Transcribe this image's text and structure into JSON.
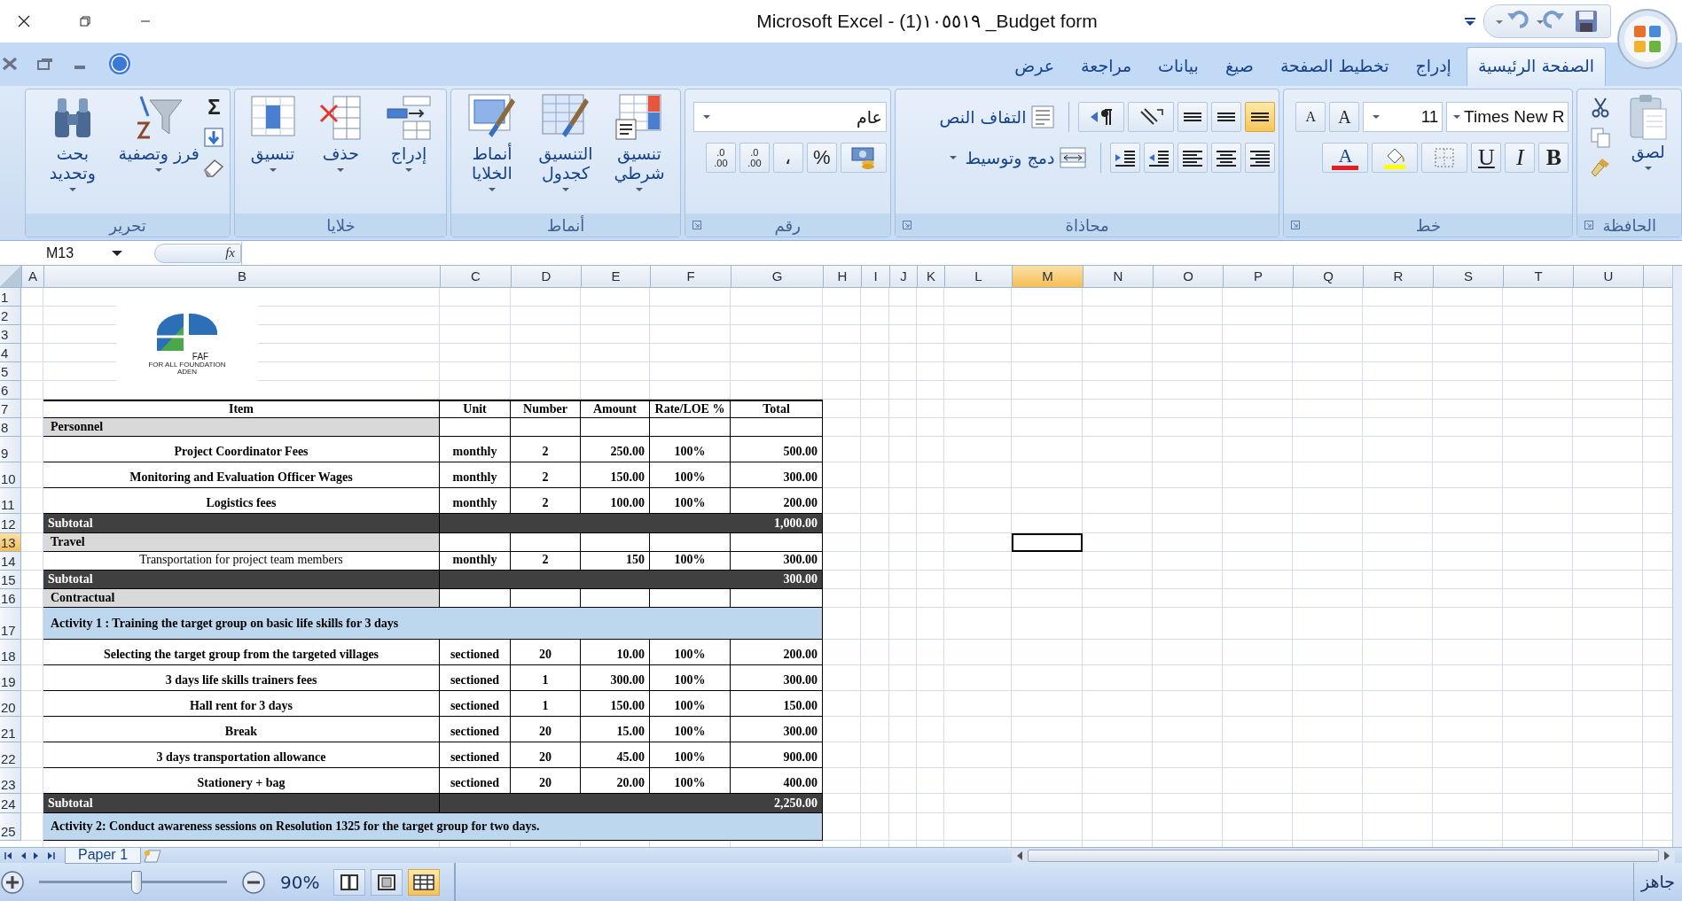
{
  "window": {
    "title": "Microsoft Excel - (1)١٠٥٥١٩ _Budget form"
  },
  "ribbon_tabs": [
    {
      "label": "الصفحة الرئيسية",
      "selected": true
    },
    {
      "label": "إدراج",
      "selected": false
    },
    {
      "label": "تخطيط الصفحة",
      "selected": false
    },
    {
      "label": "صيغ",
      "selected": false
    },
    {
      "label": "بيانات",
      "selected": false
    },
    {
      "label": "مراجعة",
      "selected": false
    },
    {
      "label": "عرض",
      "selected": false
    }
  ],
  "clipboard": {
    "title": "الحافظة",
    "paste": "لصق"
  },
  "font": {
    "title": "خط",
    "name": "Times New R",
    "size": "11",
    "grow": "A",
    "shrink": "A",
    "bold": "B",
    "italic": "I",
    "underline": "U",
    "color_letter": "A"
  },
  "alignment": {
    "title": "محاذاة",
    "wrap_text": "التفاف النص",
    "merge_center": "دمج وتوسيط"
  },
  "number": {
    "title": "رقم",
    "format": "عام",
    "percent": "%",
    "comma": "،",
    "decimals": [
      {
        "top": ".0",
        "bottom": ".00"
      },
      {
        "top": ".0",
        "bottom": ".00"
      }
    ]
  },
  "styles": {
    "title": "أنماط",
    "commands": [
      "تنسيق شرطي",
      "التنسيق كجدول",
      "أنماط الخلايا"
    ]
  },
  "cells": {
    "title": "خلايا",
    "commands": [
      "إدراج",
      "حذف",
      "تنسيق"
    ]
  },
  "editing": {
    "title": "تحرير",
    "sum": "Σ",
    "commands": [
      "فرز وتصفية",
      "بحث وتحديد"
    ]
  },
  "formula_bar": {
    "name_box": "M13",
    "function_label": "fx"
  },
  "logo": {
    "mark": "FAF",
    "line_1": "FOR ALL FOUNDATION",
    "line_2": "ADEN"
  },
  "sheet": {
    "columns": [
      {
        "label": "A",
        "selected": false
      },
      {
        "label": "B",
        "selected": false
      },
      {
        "label": "C",
        "selected": false
      },
      {
        "label": "D",
        "selected": false
      },
      {
        "label": "E",
        "selected": false
      },
      {
        "label": "F",
        "selected": false
      },
      {
        "label": "G",
        "selected": false
      },
      {
        "label": "H",
        "selected": false
      },
      {
        "label": "I",
        "selected": false
      },
      {
        "label": "J",
        "selected": false
      },
      {
        "label": "K",
        "selected": false
      },
      {
        "label": "L",
        "selected": false
      },
      {
        "label": "M",
        "selected": true
      },
      {
        "label": "N",
        "selected": false
      },
      {
        "label": "O",
        "selected": false
      },
      {
        "label": "P",
        "selected": false
      },
      {
        "label": "Q",
        "selected": false
      },
      {
        "label": "R",
        "selected": false
      },
      {
        "label": "S",
        "selected": false
      },
      {
        "label": "T",
        "selected": false
      },
      {
        "label": "U",
        "selected": false
      }
    ],
    "rows": [
      {
        "number": "1",
        "selected": false,
        "kind": "blank"
      },
      {
        "number": "2",
        "selected": false,
        "kind": "blank"
      },
      {
        "number": "3",
        "selected": false,
        "kind": "blank"
      },
      {
        "number": "4",
        "selected": false,
        "kind": "blank"
      },
      {
        "number": "5",
        "selected": false,
        "kind": "blank"
      },
      {
        "number": "6",
        "selected": false,
        "kind": "blank"
      },
      {
        "number": "7",
        "selected": false,
        "kind": "header",
        "cells": [
          "Item",
          "Unit",
          "Number",
          "Amount",
          "Rate/LOE %",
          "Total"
        ]
      },
      {
        "number": "8",
        "selected": false,
        "kind": "section",
        "label": "Personnel"
      },
      {
        "number": "9",
        "selected": false,
        "kind": "item",
        "name": "Project Coordinator Fees",
        "bold": true,
        "unit": "monthly",
        "count": "2",
        "amount": "250.00",
        "rate": "100%",
        "total": "500.00"
      },
      {
        "number": "10",
        "selected": false,
        "kind": "item",
        "name": "Monitoring and Evaluation Officer Wages",
        "bold": true,
        "unit": "monthly",
        "count": "2",
        "amount": "150.00",
        "rate": "100%",
        "total": "300.00"
      },
      {
        "number": "11",
        "selected": false,
        "kind": "item",
        "name": "Logistics fees",
        "bold": true,
        "unit": "monthly",
        "count": "2",
        "amount": "100.00",
        "rate": "100%",
        "total": "200.00"
      },
      {
        "number": "12",
        "selected": false,
        "kind": "subtotal",
        "label": "Subtotal",
        "total": "1,000.00"
      },
      {
        "number": "13",
        "selected": true,
        "kind": "section",
        "label": "Travel"
      },
      {
        "number": "14",
        "selected": false,
        "kind": "item",
        "name": "Transportation for project team members",
        "bold": false,
        "unit": "monthly",
        "count": "2",
        "amount": "150",
        "rate": "100%",
        "total": "300.00"
      },
      {
        "number": "15",
        "selected": false,
        "kind": "subtotal",
        "label": "Subtotal",
        "total": "300.00"
      },
      {
        "number": "16",
        "selected": false,
        "kind": "section",
        "label": "Contractual"
      },
      {
        "number": "17",
        "selected": false,
        "kind": "activity",
        "label": "Activity 1 : Training the target group on basic life skills for 3 days"
      },
      {
        "number": "18",
        "selected": false,
        "kind": "item",
        "name": "Selecting the target group from the targeted villages",
        "bold": true,
        "unit": "sectioned",
        "count": "20",
        "amount": "10.00",
        "rate": "100%",
        "total": "200.00"
      },
      {
        "number": "19",
        "selected": false,
        "kind": "item",
        "name": "3 days life skills trainers fees",
        "bold": true,
        "unit": "sectioned",
        "count": "1",
        "amount": "300.00",
        "rate": "100%",
        "total": "300.00"
      },
      {
        "number": "20",
        "selected": false,
        "kind": "item",
        "name": "Hall rent for 3 days",
        "bold": true,
        "unit": "sectioned",
        "count": "1",
        "amount": "150.00",
        "rate": "100%",
        "total": "150.00"
      },
      {
        "number": "21",
        "selected": false,
        "kind": "item",
        "name": "Break",
        "bold": true,
        "unit": "sectioned",
        "count": "20",
        "amount": "15.00",
        "rate": "100%",
        "total": "300.00"
      },
      {
        "number": "22",
        "selected": false,
        "kind": "item",
        "name": "3 days transportation allowance",
        "bold": true,
        "unit": "sectioned",
        "count": "20",
        "amount": "45.00",
        "rate": "100%",
        "total": "900.00"
      },
      {
        "number": "23",
        "selected": false,
        "kind": "item",
        "name": "Stationery + bag",
        "bold": true,
        "unit": "sectioned",
        "count": "20",
        "amount": "20.00",
        "rate": "100%",
        "total": "400.00"
      },
      {
        "number": "24",
        "selected": false,
        "kind": "subtotal",
        "label": "Subtotal",
        "total": "2,250.00"
      },
      {
        "number": "25",
        "selected": false,
        "kind": "activity",
        "label": "Activity 2: Conduct awareness sessions on Resolution 1325 for the target group for two days."
      }
    ]
  },
  "sheet_tabs": [
    {
      "label": "Paper 1",
      "selected": true
    }
  ],
  "status_bar": {
    "zoom": "90%",
    "zoom_slider": {
      "level": 0.52
    },
    "views": [
      {
        "kind": "page_break",
        "selected": false
      },
      {
        "kind": "page_layout",
        "selected": false
      },
      {
        "kind": "normal",
        "selected": true
      }
    ],
    "status": "جاهز"
  }
}
